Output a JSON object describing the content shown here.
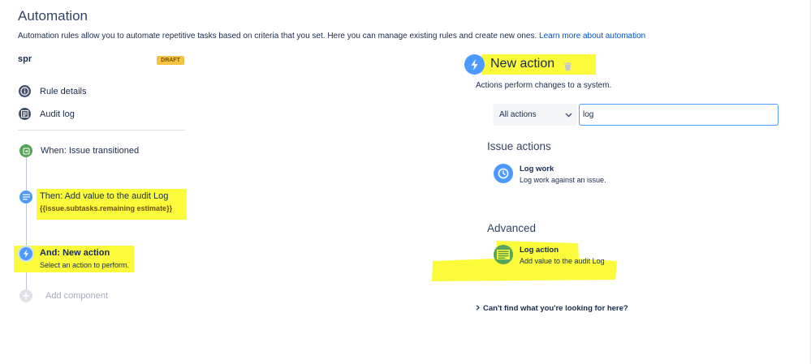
{
  "page": {
    "title": "Automation",
    "description": "Automation rules allow you to automate repetitive tasks based on criteria that you set. Here you can manage existing rules and create new ones.",
    "learn_more": "Learn more about automation"
  },
  "rule": {
    "name": "spr",
    "status_badge": "DRAFT"
  },
  "nav": {
    "rule_details": "Rule details",
    "audit_log": "Audit log"
  },
  "timeline": {
    "trigger": "When: Issue transitioned",
    "action1_title": "Then: Add value to the audit Log",
    "action1_value": "{{issue.subtasks.remaining estimate}}",
    "action2_title": "And: New action",
    "action2_sub": "Select an action to perform.",
    "add_component": "Add component"
  },
  "panel": {
    "title": "New action",
    "subtitle": "Actions perform changes to a system.",
    "filter_select": "All actions",
    "search_value": "log",
    "sections": {
      "issue_actions": {
        "title": "Issue actions",
        "item_title": "Log work",
        "item_desc": "Log work against an issue."
      },
      "advanced": {
        "title": "Advanced",
        "item_title": "Log action",
        "item_desc": "Add value to the audit Log"
      }
    },
    "cant_find": "Can't find what you're looking for here?"
  },
  "colors": {
    "highlight": "#fbfb3c",
    "link": "#0052cc",
    "badge": "#f5c343",
    "trigger_green": "#57a55a",
    "action_blue": "#4c9aff",
    "new_action_blue": "#4c9aff"
  },
  "icons": {
    "rule_details": "info-icon",
    "audit_log": "list-icon",
    "trigger": "transition-icon",
    "action": "audit-log-icon",
    "new_action": "lightning-icon",
    "add": "plus-icon",
    "delete": "trash-icon",
    "log_work": "clock-icon",
    "log_action": "log-lines-icon",
    "select": "chevron-down-icon",
    "cant_find": "chevron-right-icon"
  }
}
